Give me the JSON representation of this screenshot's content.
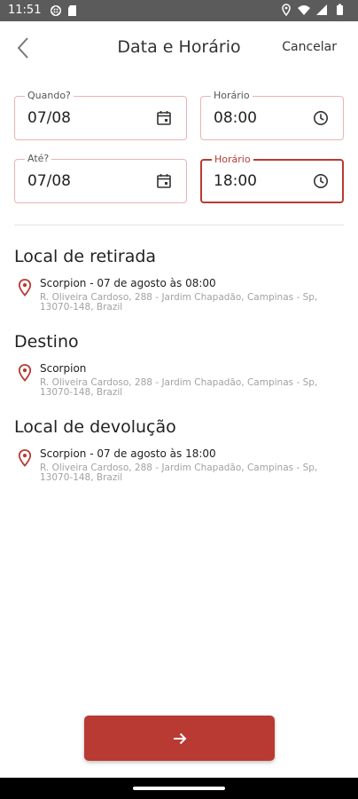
{
  "status_bar": {
    "time": "11:51",
    "left_icons": [
      "sync-icon",
      "sd-card-icon"
    ],
    "right_icons": [
      "location-icon",
      "wifi-icon",
      "signal-icon",
      "battery-icon"
    ]
  },
  "header": {
    "title": "Data e Horário",
    "cancel_label": "Cancelar",
    "back_icon": "chevron-left-icon"
  },
  "form": {
    "start_date": {
      "label": "Quando?",
      "value": "07/08",
      "icon": "calendar-icon"
    },
    "start_time": {
      "label": "Horário",
      "value": "08:00",
      "icon": "clock-icon"
    },
    "end_date": {
      "label": "Até?",
      "value": "07/08",
      "icon": "calendar-icon"
    },
    "end_time": {
      "label": "Horário",
      "value": "18:00",
      "icon": "clock-icon",
      "focused": true
    }
  },
  "sections": {
    "pickup": {
      "title": "Local de retirada",
      "name": "Scorpion - 07 de agosto às 08:00",
      "address": "R. Oliveira Cardoso, 288 - Jardim Chapadão, Campinas - Sp, 13070-148, Brazil"
    },
    "destination": {
      "title": "Destino",
      "name": "Scorpion",
      "address": "R. Oliveira Cardoso, 288 - Jardim Chapadão, Campinas - Sp, 13070-148, Brazil"
    },
    "return": {
      "title": "Local de devolução",
      "name": "Scorpion - 07 de agosto às 18:00",
      "address": "R. Oliveira Cardoso, 288 - Jardim Chapadão, Campinas - Sp, 13070-148, Brazil"
    }
  },
  "next_button": {
    "icon": "arrow-right-icon"
  },
  "colors": {
    "accent": "#b93a32",
    "field_border": "#e8b4b0",
    "status_bar": "#5b5b5b"
  }
}
